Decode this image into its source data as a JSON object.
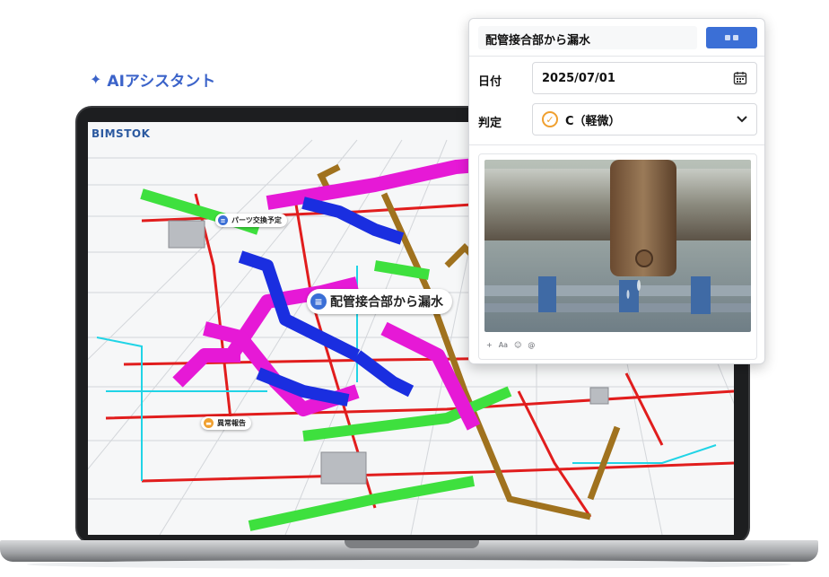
{
  "ai_header": {
    "icon": "sparkle-icon",
    "label": "AIアシスタント"
  },
  "app": {
    "brand": "BIMSTOK"
  },
  "pins": {
    "parts": {
      "label": "パーツ交換予定",
      "color": "#3b6fd6",
      "icon": "document-icon"
    },
    "leak": {
      "label": "配管接合部から漏水",
      "color": "#3b6fd6",
      "icon": "document-icon"
    },
    "anomaly": {
      "label": "異常報告",
      "color": "#f0a030",
      "icon": "folder-icon"
    }
  },
  "card": {
    "title": "配管接合部から漏水",
    "date_label": "日付",
    "date_value": "2025/07/01",
    "judge_label": "判定",
    "judge_value": "C（軽微）",
    "toolbar": [
      "+",
      "Aa",
      "☺",
      "@"
    ]
  },
  "colors": {
    "accent": "#3b6fd6",
    "warning": "#f0a030",
    "pipe_magenta": "#e619d6",
    "pipe_blue": "#1a2ee0",
    "pipe_green": "#3ee03e",
    "pipe_brown": "#a0721e",
    "pipe_red": "#e11d1d",
    "pipe_cyan": "#20d4e6"
  }
}
